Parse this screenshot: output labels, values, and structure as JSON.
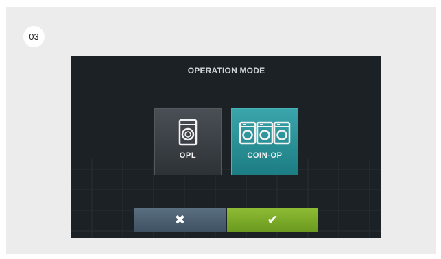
{
  "step": {
    "number": "03"
  },
  "screen": {
    "title": "OPERATION MODE",
    "modes": [
      {
        "label": "OPL",
        "icon": "washing-machine-icon",
        "selected": false
      },
      {
        "label": "COIN-OP",
        "icon": "three-washing-machines-icon",
        "selected": true
      }
    ],
    "actions": {
      "cancel_icon": "✖",
      "confirm_icon": "✔"
    }
  },
  "colors": {
    "frame_bg": "#ececec",
    "screen_bg": "#1c2126",
    "selected_accent": "#2a949a",
    "cancel_bg": "#4e6374",
    "confirm_bg": "#7eab2a"
  }
}
